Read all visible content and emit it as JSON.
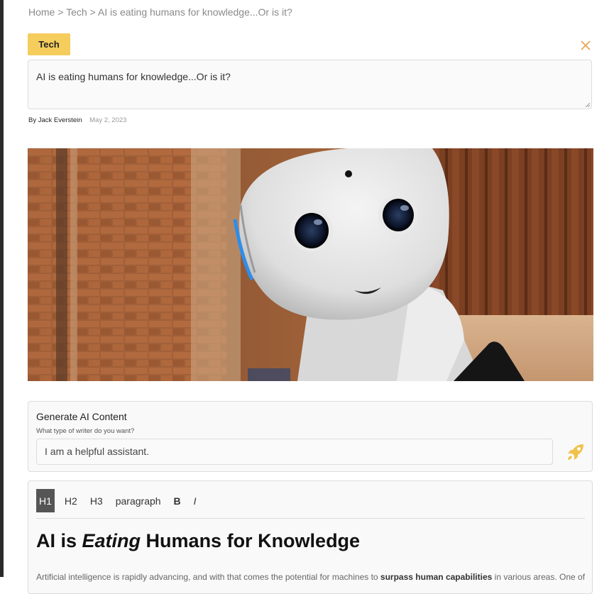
{
  "breadcrumb": {
    "home": "Home",
    "sep1": ">",
    "category": "Tech",
    "sep2": ">",
    "current": "AI is eating humans for knowledge...Or is it?"
  },
  "post": {
    "category_badge": "Tech",
    "title": "AI is eating humans for knowledge...Or is it?",
    "author": "By Jack Everstein",
    "date": "May 2, 2023"
  },
  "ai_panel": {
    "title": "Generate AI Content",
    "subtitle": "What type of writer do you want?",
    "input_value": "I am a helpful assistant.",
    "submit_icon": "rocket-icon"
  },
  "editor": {
    "toolbar": {
      "h1": "H1",
      "h2": "H2",
      "h3": "H3",
      "paragraph": "paragraph",
      "bold": "B",
      "italic": "I"
    },
    "heading_pre": "AI is ",
    "heading_em": "Eating",
    "heading_post": " Humans for Knowledge",
    "body_pre": "Artificial intelligence is rapidly advancing, and with that comes the potential for machines to ",
    "body_bold": "surpass human capabilities",
    "body_post": " in various areas. One of"
  },
  "colors": {
    "accent": "#f5cd5c",
    "close": "#e8a24a",
    "rocket": "#f0c24b"
  }
}
